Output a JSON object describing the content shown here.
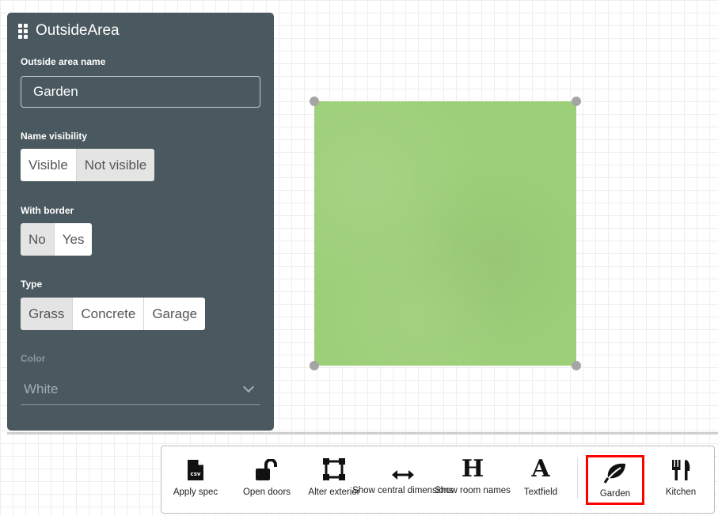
{
  "panel": {
    "title": "OutsideArea",
    "name_label": "Outside area name",
    "name_value": "Garden",
    "visibility_label": "Name visibility",
    "visibility_options": [
      "Visible",
      "Not visible"
    ],
    "border_label": "With border",
    "border_options": [
      "No",
      "Yes"
    ],
    "type_label": "Type",
    "type_options": [
      "Grass",
      "Concrete",
      "Garage"
    ],
    "color_label": "Color",
    "color_value": "White"
  },
  "canvas": {
    "shape_color": "#9dcf79"
  },
  "toolbar": {
    "items": [
      {
        "label": "Apply spec",
        "icon": "csv-file-icon"
      },
      {
        "label": "Open doors",
        "icon": "unlocked-padlock-icon"
      },
      {
        "label": "Alter exterior",
        "icon": "resize-square-icon"
      },
      {
        "label": "Show central dimensions",
        "icon": "horizontal-arrows-icon"
      },
      {
        "label": "Show room names",
        "icon": "letter-h-icon"
      },
      {
        "label": "Textfield",
        "icon": "letter-a-icon"
      },
      {
        "label": "Garden",
        "icon": "leaf-icon"
      },
      {
        "label": "Kitchen",
        "icon": "fork-knife-icon"
      }
    ],
    "selected": "Garden"
  }
}
